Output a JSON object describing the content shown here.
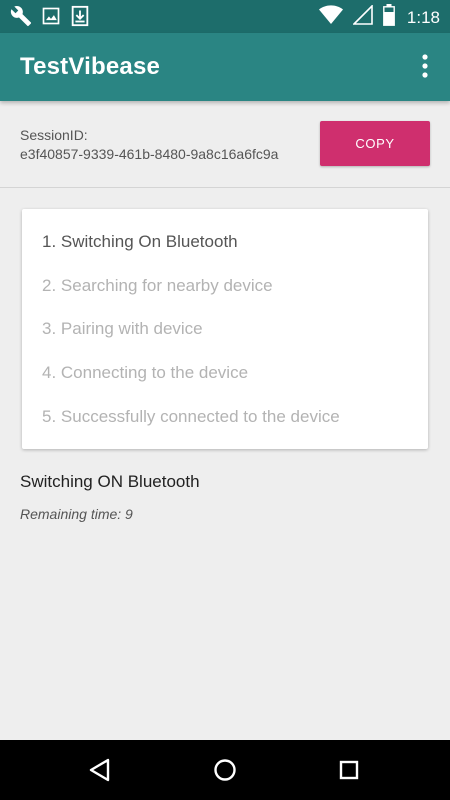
{
  "status_bar": {
    "time": "1:18",
    "left_icons": [
      "wrench-icon",
      "image-icon",
      "download-icon"
    ],
    "right_icons": [
      "wifi-icon",
      "signal-icon",
      "battery-icon"
    ]
  },
  "app_bar": {
    "title": "TestVibease",
    "menu_icon": "overflow-menu-icon"
  },
  "session": {
    "label": "SessionID:",
    "id": "e3f40857-9339-461b-8480-9a8c16a6fc9a",
    "copy_label": "COPY"
  },
  "steps": [
    {
      "label": "1. Switching On Bluetooth",
      "active": true
    },
    {
      "label": "2. Searching for nearby device",
      "active": false
    },
    {
      "label": "3. Pairing with device",
      "active": false
    },
    {
      "label": "4. Connecting to the device",
      "active": false
    },
    {
      "label": "5. Successfully connected to the device",
      "active": false
    }
  ],
  "status": {
    "current": "Switching ON Bluetooth",
    "remaining": "Remaining time: 9"
  },
  "colors": {
    "status_bar": "#1d6d6b",
    "app_bar": "#2a8583",
    "accent": "#cf2f6e",
    "background": "#eeeeee"
  },
  "nav_bar": {
    "buttons": [
      "back-icon",
      "home-icon",
      "recents-icon"
    ]
  }
}
